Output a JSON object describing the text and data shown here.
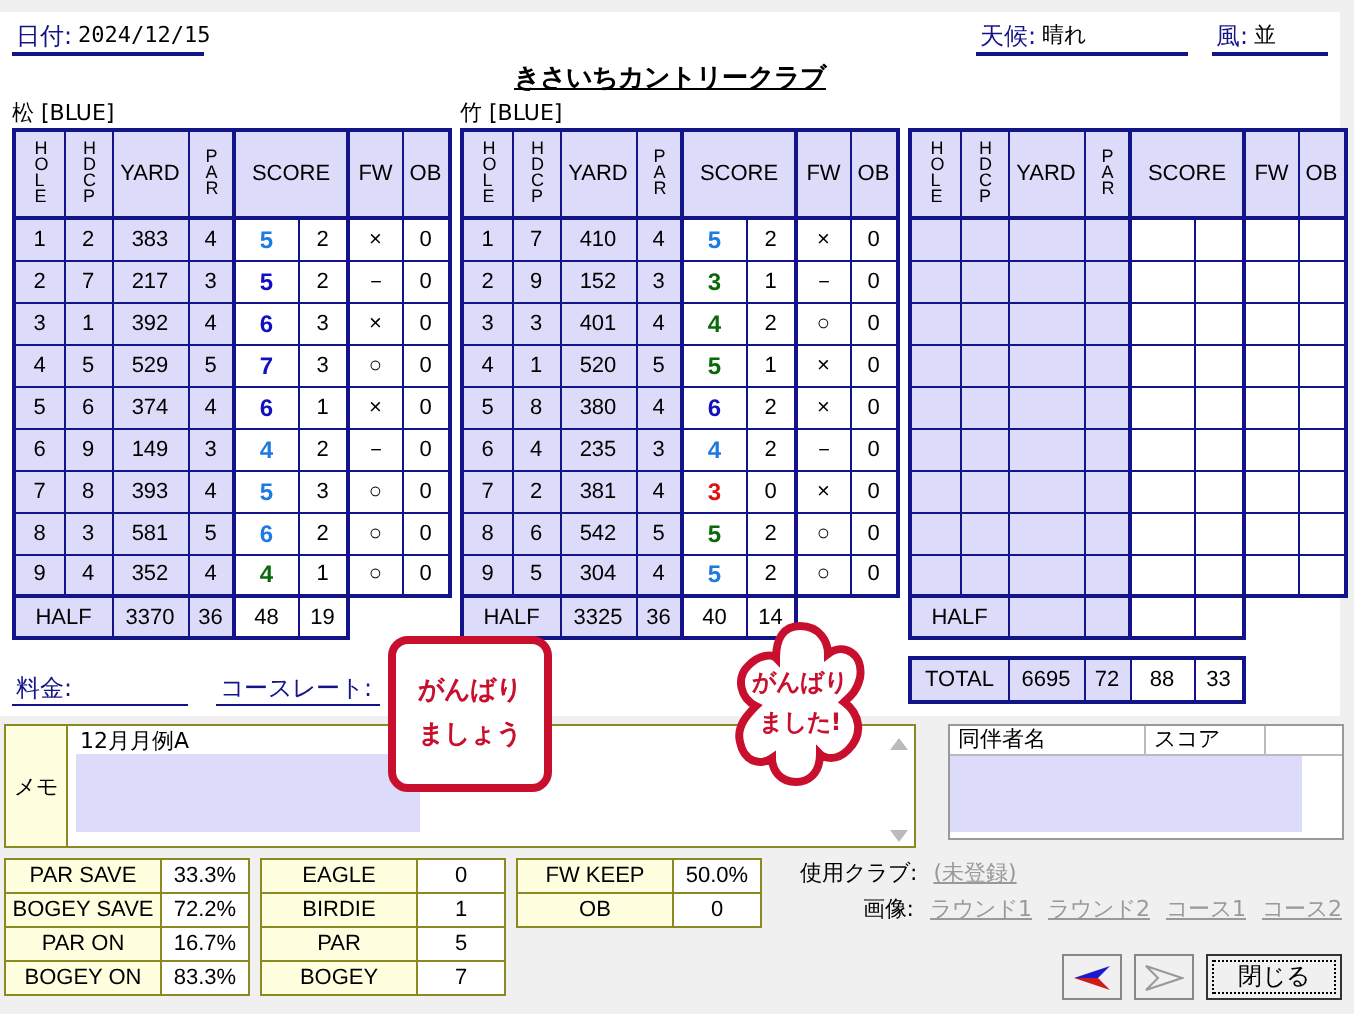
{
  "header": {
    "date": {
      "label": "日付:",
      "value": "2024/12/15"
    },
    "weather": {
      "label": "天候:",
      "value": "晴れ"
    },
    "wind": {
      "label": "風:",
      "value": "並"
    },
    "title": "きさいちカントリークラブ"
  },
  "courses": [
    {
      "name": "松 [BLUE]",
      "columns": [
        {
          "label": "HOLE",
          "vertical": true
        },
        {
          "label": "HDCP",
          "vertical": true
        },
        {
          "label": "YARD",
          "vertical": false
        },
        {
          "label": "PAR",
          "vertical": true
        },
        {
          "label": "SCORE",
          "vertical": false
        },
        {
          "label": "FW",
          "vertical": false
        },
        {
          "label": "OB",
          "vertical": false
        }
      ],
      "holes": [
        {
          "hole": "1",
          "hdcp": "2",
          "yard": "383",
          "par": "4",
          "score": "5",
          "color": "#1e7be0",
          "putts": "2",
          "fw": "×",
          "ob": "0"
        },
        {
          "hole": "2",
          "hdcp": "7",
          "yard": "217",
          "par": "3",
          "score": "5",
          "color": "#1010c0",
          "putts": "2",
          "fw": "－",
          "ob": "0"
        },
        {
          "hole": "3",
          "hdcp": "1",
          "yard": "392",
          "par": "4",
          "score": "6",
          "color": "#1010c0",
          "putts": "3",
          "fw": "×",
          "ob": "0"
        },
        {
          "hole": "4",
          "hdcp": "5",
          "yard": "529",
          "par": "5",
          "score": "7",
          "color": "#1010c0",
          "putts": "3",
          "fw": "○",
          "ob": "0"
        },
        {
          "hole": "5",
          "hdcp": "6",
          "yard": "374",
          "par": "4",
          "score": "6",
          "color": "#1010c0",
          "putts": "1",
          "fw": "×",
          "ob": "0"
        },
        {
          "hole": "6",
          "hdcp": "9",
          "yard": "149",
          "par": "3",
          "score": "4",
          "color": "#1e7be0",
          "putts": "2",
          "fw": "－",
          "ob": "0"
        },
        {
          "hole": "7",
          "hdcp": "8",
          "yard": "393",
          "par": "4",
          "score": "5",
          "color": "#1e7be0",
          "putts": "3",
          "fw": "○",
          "ob": "0"
        },
        {
          "hole": "8",
          "hdcp": "3",
          "yard": "581",
          "par": "5",
          "score": "6",
          "color": "#1e7be0",
          "putts": "2",
          "fw": "○",
          "ob": "0"
        },
        {
          "hole": "9",
          "hdcp": "4",
          "yard": "352",
          "par": "4",
          "score": "4",
          "color": "#0a6a0a",
          "putts": "1",
          "fw": "○",
          "ob": "0"
        }
      ],
      "half": {
        "label": "HALF",
        "yard": "3370",
        "par": "36",
        "score": "48",
        "putts": "19"
      }
    },
    {
      "name": "竹 [BLUE]",
      "columns": [
        {
          "label": "HOLE",
          "vertical": true
        },
        {
          "label": "HDCP",
          "vertical": true
        },
        {
          "label": "YARD",
          "vertical": false
        },
        {
          "label": "PAR",
          "vertical": true
        },
        {
          "label": "SCORE",
          "vertical": false
        },
        {
          "label": "FW",
          "vertical": false
        },
        {
          "label": "OB",
          "vertical": false
        }
      ],
      "holes": [
        {
          "hole": "1",
          "hdcp": "7",
          "yard": "410",
          "par": "4",
          "score": "5",
          "color": "#1e7be0",
          "putts": "2",
          "fw": "×",
          "ob": "0"
        },
        {
          "hole": "2",
          "hdcp": "9",
          "yard": "152",
          "par": "3",
          "score": "3",
          "color": "#0a6a0a",
          "putts": "1",
          "fw": "－",
          "ob": "0"
        },
        {
          "hole": "3",
          "hdcp": "3",
          "yard": "401",
          "par": "4",
          "score": "4",
          "color": "#0a6a0a",
          "putts": "2",
          "fw": "○",
          "ob": "0"
        },
        {
          "hole": "4",
          "hdcp": "1",
          "yard": "520",
          "par": "5",
          "score": "5",
          "color": "#0a6a0a",
          "putts": "1",
          "fw": "×",
          "ob": "0"
        },
        {
          "hole": "5",
          "hdcp": "8",
          "yard": "380",
          "par": "4",
          "score": "6",
          "color": "#1010c0",
          "putts": "2",
          "fw": "×",
          "ob": "0"
        },
        {
          "hole": "6",
          "hdcp": "4",
          "yard": "235",
          "par": "3",
          "score": "4",
          "color": "#1e7be0",
          "putts": "2",
          "fw": "－",
          "ob": "0"
        },
        {
          "hole": "7",
          "hdcp": "2",
          "yard": "381",
          "par": "4",
          "score": "3",
          "color": "#e01010",
          "putts": "0",
          "fw": "×",
          "ob": "0"
        },
        {
          "hole": "8",
          "hdcp": "6",
          "yard": "542",
          "par": "5",
          "score": "5",
          "color": "#0a6a0a",
          "putts": "2",
          "fw": "○",
          "ob": "0"
        },
        {
          "hole": "9",
          "hdcp": "5",
          "yard": "304",
          "par": "4",
          "score": "5",
          "color": "#1e7be0",
          "putts": "2",
          "fw": "○",
          "ob": "0"
        }
      ],
      "half": {
        "label": "HALF",
        "yard": "3325",
        "par": "36",
        "score": "40",
        "putts": "14"
      }
    },
    {
      "columns": [
        {
          "label": "HOLE",
          "vertical": true
        },
        {
          "label": "HDCP",
          "vertical": true
        },
        {
          "label": "YARD",
          "vertical": false
        },
        {
          "label": "PAR",
          "vertical": true
        },
        {
          "label": "SCORE",
          "vertical": false
        },
        {
          "label": "FW",
          "vertical": false
        },
        {
          "label": "OB",
          "vertical": false
        }
      ],
      "half": {
        "label": "HALF"
      }
    }
  ],
  "total": {
    "label": "TOTAL",
    "yard": "6695",
    "par": "72",
    "score": "88",
    "putts": "33"
  },
  "fee": {
    "label": "料金:"
  },
  "course_rate": {
    "label": "コースレート:"
  },
  "stickers": [
    {
      "kind": "square",
      "lines": [
        "がんばり",
        "ましょう"
      ]
    },
    {
      "kind": "flower",
      "lines": [
        "がんばり",
        "ました!"
      ]
    }
  ],
  "memo": {
    "label": "メモ",
    "value": "12月月例A"
  },
  "companions": {
    "columns": [
      "同伴者名",
      "スコア"
    ]
  },
  "stats": [
    [
      {
        "label": "PAR SAVE",
        "value": "33.3%"
      },
      {
        "label": "BOGEY SAVE",
        "value": "72.2%"
      },
      {
        "label": "PAR ON",
        "value": "16.7%"
      },
      {
        "label": "BOGEY ON",
        "value": "83.3%"
      }
    ],
    [
      {
        "label": "EAGLE",
        "value": "0"
      },
      {
        "label": "BIRDIE",
        "value": "1"
      },
      {
        "label": "PAR",
        "value": "5"
      },
      {
        "label": "BOGEY",
        "value": "7"
      }
    ],
    [
      {
        "label": "FW KEEP",
        "value": "50.0%"
      },
      {
        "label": "OB",
        "value": "0"
      }
    ]
  ],
  "clubs": {
    "label": "使用クラブ:",
    "link": "(未登録)"
  },
  "images": {
    "label": "画像:",
    "links": [
      "ラウンド1",
      "ラウンド2",
      "コース1",
      "コース2"
    ]
  },
  "buttons": {
    "prev": {
      "disabled": false
    },
    "next": {
      "disabled": true
    },
    "close": {
      "label": "閉じる"
    }
  }
}
